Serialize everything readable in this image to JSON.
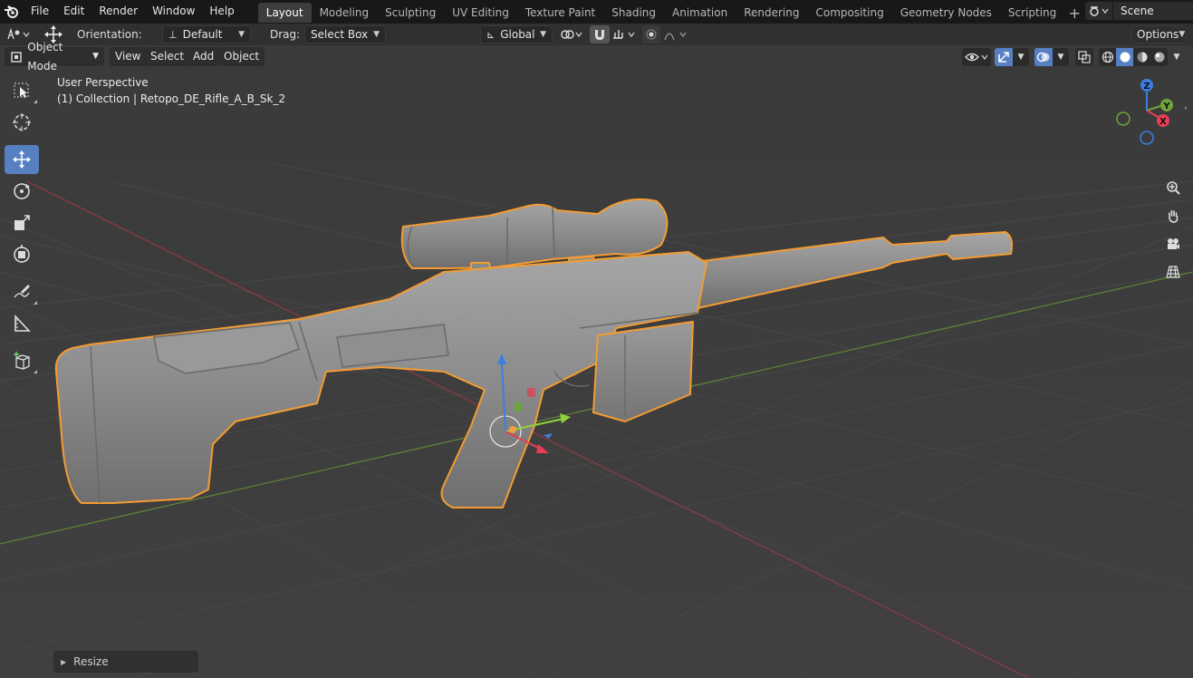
{
  "menubar": {
    "items": [
      "File",
      "Edit",
      "Render",
      "Window",
      "Help"
    ]
  },
  "workspaces": {
    "tabs": [
      "Layout",
      "Modeling",
      "Sculpting",
      "UV Editing",
      "Texture Paint",
      "Shading",
      "Animation",
      "Rendering",
      "Compositing",
      "Geometry Nodes",
      "Scripting"
    ],
    "active": "Layout",
    "add_label": "+"
  },
  "scene": {
    "name": "Scene"
  },
  "tool_header": {
    "orientation_label": "Orientation:",
    "orientation_value": "Default",
    "drag_label": "Drag:",
    "drag_value": "Select Box",
    "transform_orientation": "Global",
    "options_label": "Options"
  },
  "viewport_header": {
    "mode": "Object Mode",
    "menus": [
      "View",
      "Select",
      "Add",
      "Object"
    ]
  },
  "viewport_info": {
    "perspective": "User Perspective",
    "collection": "(1) Collection | Retopo_DE_Rifle_A_B_Sk_2"
  },
  "gizmo": {
    "z_label": "Z",
    "y_label": "Y",
    "x_label": "X",
    "x_color": "#e83e52",
    "y_color": "#6fa438",
    "z_color": "#3a7fe0"
  },
  "last_operator": {
    "label": "Resize"
  },
  "colors": {
    "accent": "#5680c2",
    "selection_outline": "#f39c32",
    "background": "#3d3d3d"
  },
  "left_toolbar": {
    "tools": [
      "select-box",
      "cursor",
      "move",
      "rotate",
      "scale",
      "transform",
      "annotate",
      "measure",
      "add-cube"
    ],
    "active": "move"
  }
}
